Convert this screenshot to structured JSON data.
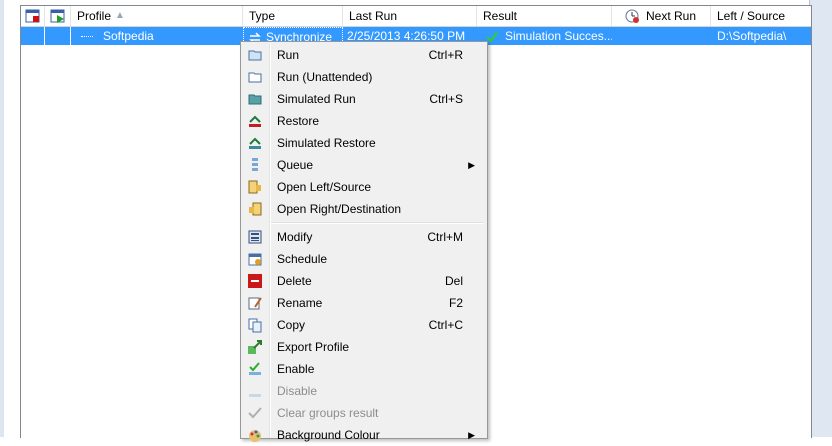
{
  "header": {
    "columns": [
      "Profile",
      "Type",
      "Last Run",
      "Result",
      "Next Run",
      "Left / Source"
    ],
    "sort_indicator": "▲"
  },
  "row": {
    "profile": "Softpedia",
    "type": "Synchronize",
    "last_run": "2/25/2013 4:26:50 PM",
    "result": "Simulation Succes...",
    "next_run": "",
    "left_source": "D:\\Softpedia\\"
  },
  "menu": {
    "items": [
      {
        "label": "Run",
        "shortcut": "Ctrl+R",
        "icon": "run-icon"
      },
      {
        "label": "Run (Unattended)",
        "shortcut": "",
        "icon": "run-unattended-icon"
      },
      {
        "label": "Simulated Run",
        "shortcut": "Ctrl+S",
        "icon": "simulated-run-icon"
      },
      {
        "label": "Restore",
        "shortcut": "",
        "icon": "restore-icon"
      },
      {
        "label": "Simulated Restore",
        "shortcut": "",
        "icon": "simulated-restore-icon"
      },
      {
        "label": "Queue",
        "shortcut": "",
        "icon": "queue-icon",
        "submenu": true
      },
      {
        "label": "Open Left/Source",
        "shortcut": "",
        "icon": "open-folder-icon"
      },
      {
        "label": "Open Right/Destination",
        "shortcut": "",
        "icon": "open-folder-icon"
      },
      {
        "label": "Modify",
        "shortcut": "Ctrl+M",
        "icon": "modify-icon"
      },
      {
        "label": "Schedule",
        "shortcut": "",
        "icon": "schedule-icon"
      },
      {
        "label": "Delete",
        "shortcut": "Del",
        "icon": "delete-icon"
      },
      {
        "label": "Rename",
        "shortcut": "F2",
        "icon": "rename-icon"
      },
      {
        "label": "Copy",
        "shortcut": "Ctrl+C",
        "icon": "copy-icon"
      },
      {
        "label": "Export Profile",
        "shortcut": "",
        "icon": "export-icon"
      },
      {
        "label": "Enable",
        "shortcut": "",
        "icon": "enable-icon"
      },
      {
        "label": "Disable",
        "shortcut": "",
        "icon": "disable-icon",
        "disabled": true
      },
      {
        "label": "Clear groups result",
        "shortcut": "",
        "icon": "checkmark-icon",
        "disabled": true
      },
      {
        "label": "Background Colour",
        "shortcut": "",
        "icon": "palette-icon",
        "submenu": true
      }
    ]
  },
  "colors": {
    "selection": "#3399ff",
    "menu_bg": "#f0f0f0"
  }
}
